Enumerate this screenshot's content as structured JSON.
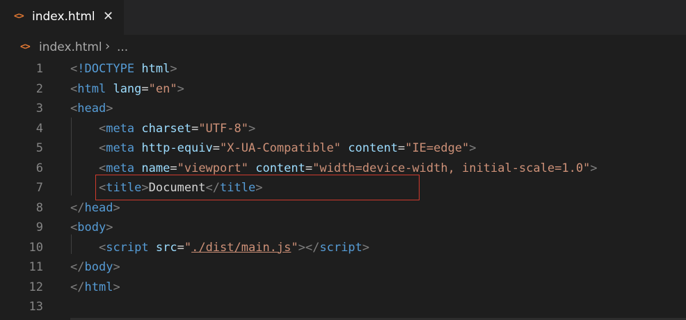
{
  "tab": {
    "icon": "<>",
    "label": "index.html",
    "close": "✕"
  },
  "breadcrumb": {
    "icon": "<>",
    "file": "index.html",
    "separator": "›",
    "more": "..."
  },
  "lines": [
    {
      "n": "1",
      "parts": [
        [
          "p",
          "<"
        ],
        [
          "t",
          "!DOCTYPE"
        ],
        [
          "txt",
          " "
        ],
        [
          "a",
          "html"
        ],
        [
          "p",
          ">"
        ]
      ]
    },
    {
      "n": "2",
      "parts": [
        [
          "p",
          "<"
        ],
        [
          "t",
          "html"
        ],
        [
          "txt",
          " "
        ],
        [
          "a",
          "lang"
        ],
        [
          "txt",
          "="
        ],
        [
          "s",
          "\"en\""
        ],
        [
          "p",
          ">"
        ]
      ]
    },
    {
      "n": "3",
      "parts": [
        [
          "p",
          "<"
        ],
        [
          "t",
          "head"
        ],
        [
          "p",
          ">"
        ]
      ]
    },
    {
      "n": "4",
      "parts": [
        [
          "txt",
          "    "
        ],
        [
          "p",
          "<"
        ],
        [
          "t",
          "meta"
        ],
        [
          "txt",
          " "
        ],
        [
          "a",
          "charset"
        ],
        [
          "txt",
          "="
        ],
        [
          "s",
          "\"UTF-8\""
        ],
        [
          "p",
          ">"
        ]
      ]
    },
    {
      "n": "5",
      "parts": [
        [
          "txt",
          "    "
        ],
        [
          "p",
          "<"
        ],
        [
          "t",
          "meta"
        ],
        [
          "txt",
          " "
        ],
        [
          "a",
          "http-equiv"
        ],
        [
          "txt",
          "="
        ],
        [
          "s",
          "\"X-UA-Compatible\""
        ],
        [
          "txt",
          " "
        ],
        [
          "a",
          "content"
        ],
        [
          "txt",
          "="
        ],
        [
          "s",
          "\"IE=edge\""
        ],
        [
          "p",
          ">"
        ]
      ]
    },
    {
      "n": "6",
      "parts": [
        [
          "txt",
          "    "
        ],
        [
          "p",
          "<"
        ],
        [
          "t",
          "meta"
        ],
        [
          "txt",
          " "
        ],
        [
          "a",
          "name"
        ],
        [
          "txt",
          "="
        ],
        [
          "s",
          "\"viewport\""
        ],
        [
          "txt",
          " "
        ],
        [
          "a",
          "content"
        ],
        [
          "txt",
          "="
        ],
        [
          "s",
          "\"width=device-width, initial-scale=1.0\""
        ],
        [
          "p",
          ">"
        ]
      ]
    },
    {
      "n": "7",
      "parts": [
        [
          "txt",
          "    "
        ],
        [
          "p",
          "<"
        ],
        [
          "t",
          "title"
        ],
        [
          "p",
          ">"
        ],
        [
          "txt",
          "Document"
        ],
        [
          "p",
          "</"
        ],
        [
          "t",
          "title"
        ],
        [
          "p",
          ">"
        ]
      ]
    },
    {
      "n": "8",
      "parts": [
        [
          "p",
          "</"
        ],
        [
          "t",
          "head"
        ],
        [
          "p",
          ">"
        ]
      ]
    },
    {
      "n": "9",
      "parts": [
        [
          "p",
          "<"
        ],
        [
          "t",
          "body"
        ],
        [
          "p",
          ">"
        ]
      ]
    },
    {
      "n": "10",
      "parts": [
        [
          "txt",
          "    "
        ],
        [
          "p",
          "<"
        ],
        [
          "t",
          "script"
        ],
        [
          "txt",
          " "
        ],
        [
          "a",
          "src"
        ],
        [
          "txt",
          "="
        ],
        [
          "s",
          "\""
        ],
        [
          "su",
          "./dist/main.js"
        ],
        [
          "s",
          "\""
        ],
        [
          "p",
          "></"
        ],
        [
          "t",
          "script"
        ],
        [
          "p",
          ">"
        ]
      ]
    },
    {
      "n": "11",
      "parts": [
        [
          "p",
          "</"
        ],
        [
          "t",
          "body"
        ],
        [
          "p",
          ">"
        ]
      ]
    },
    {
      "n": "12",
      "parts": [
        [
          "p",
          "</"
        ],
        [
          "t",
          "html"
        ],
        [
          "p",
          ">"
        ]
      ]
    },
    {
      "n": "13",
      "parts": []
    }
  ],
  "colors": {
    "background": "#1e1e1e",
    "tag": "#569cd6",
    "attribute": "#9cdcfe",
    "string": "#ce9178",
    "punctuation": "#808080",
    "highlight_border": "#d13b2e"
  }
}
